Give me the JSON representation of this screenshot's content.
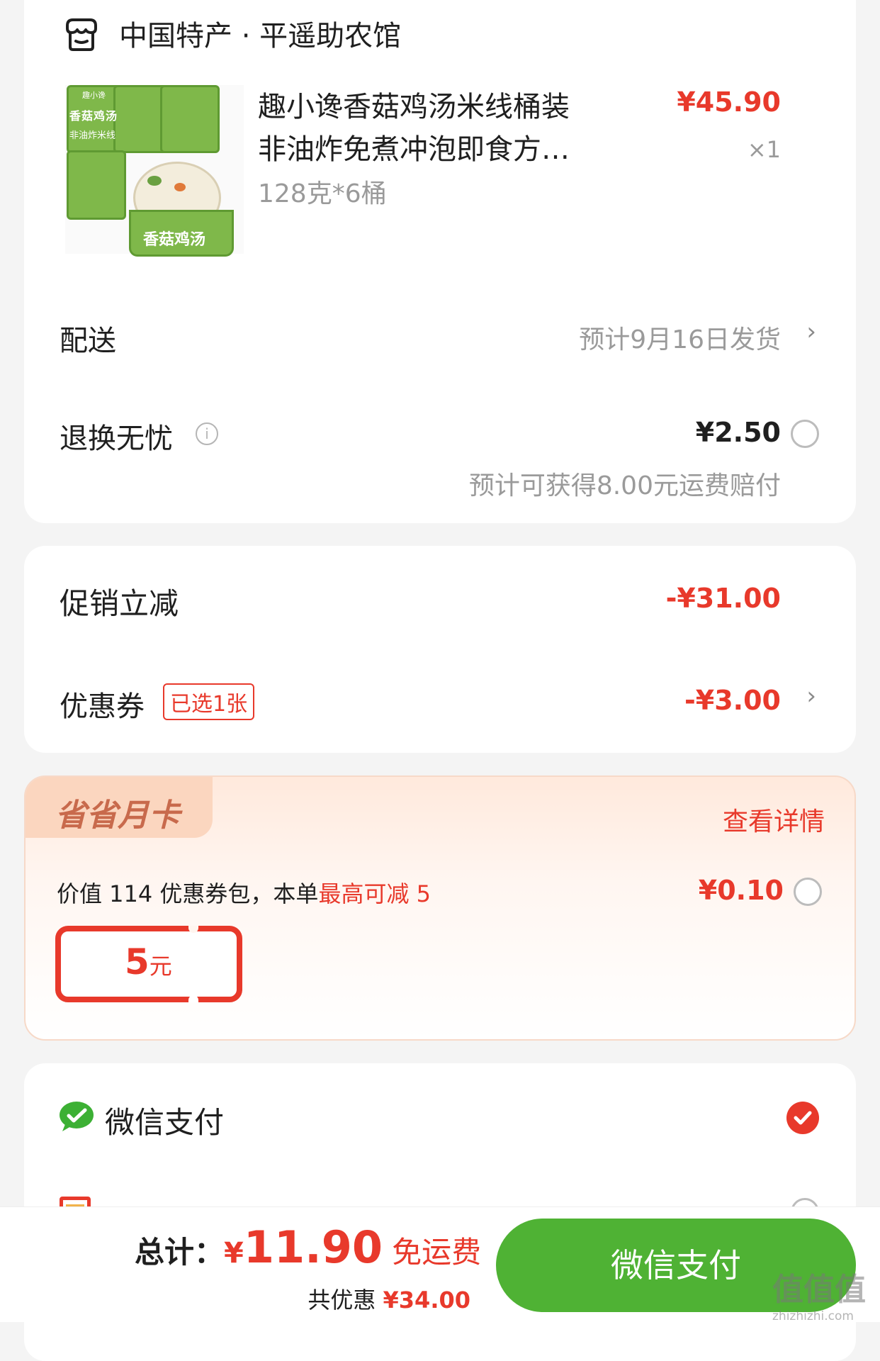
{
  "shop": {
    "icon": "store-icon",
    "name": "中国特产 · 平遥助农馆"
  },
  "product": {
    "title_line1": "趣小谗香菇鸡汤米线桶装",
    "title_line2": "非油炸免煮冲泡即食方…",
    "spec": "128克*6桶",
    "price": "¥45.90",
    "quantity": "×1",
    "image": {
      "icon": "product-image",
      "lines": [
        "香菇鸡汤",
        "非油炸米线"
      ],
      "sub": "趣小谗",
      "cup_label": "香菇鸡汤"
    }
  },
  "delivery": {
    "label": "配送",
    "value": "预计9月16日发货"
  },
  "return_insurance": {
    "label": "退换无忧",
    "price": "¥2.50",
    "note": "预计可获得8.00元运费赔付"
  },
  "promo": {
    "label": "促销立减",
    "value": "-¥31.00"
  },
  "coupon": {
    "label": "优惠券",
    "badge": "已选1张",
    "value": "-¥3.00"
  },
  "month_card": {
    "title": "省省月卡",
    "details_link": "查看详情",
    "desc_prefix": "价值 114 优惠券包，本单",
    "desc_highlight": "最高可减 5",
    "price": "¥0.10",
    "voucher_amount": "5",
    "voucher_unit": "元"
  },
  "payment": {
    "wechat_label": "微信支付",
    "wechat_icon": "wechat-pay-icon",
    "other_icon": "card-icon",
    "other_label": ""
  },
  "footer": {
    "total_label": "总计：",
    "currency": "¥",
    "total": "11.90",
    "free_shipping": "免运费",
    "saved_label": "共优惠",
    "saved": "¥34.00",
    "pay_button": "微信支付"
  },
  "watermark": {
    "main": "值值值",
    "sub": "zhizhizhi.com"
  },
  "colors": {
    "accent_red": "#e8392b",
    "pay_green": "#4fb234",
    "wechat_green": "#3cb034",
    "card_bg": "#fff4ee"
  }
}
